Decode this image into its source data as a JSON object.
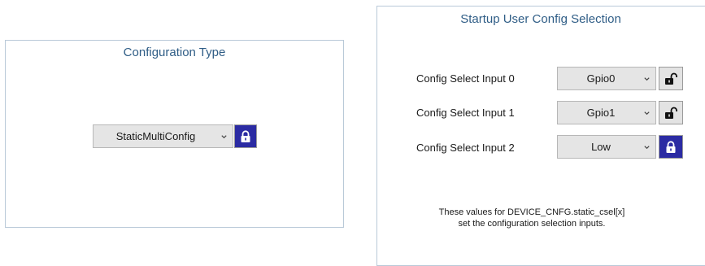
{
  "config_type_panel": {
    "title": "Configuration Type",
    "select_value": "StaticMultiConfig",
    "lock_state": "locked",
    "lock_icon": "lock-closed-icon"
  },
  "startup_panel": {
    "title": "Startup User Config Selection",
    "rows": [
      {
        "label": "Config Select Input 0",
        "value": "Gpio0",
        "lock_state": "unlocked",
        "lock_icon": "lock-open-icon"
      },
      {
        "label": "Config Select Input 1",
        "value": "Gpio1",
        "lock_state": "unlocked",
        "lock_icon": "lock-open-icon"
      },
      {
        "label": "Config Select Input 2",
        "value": "Low",
        "lock_state": "locked",
        "lock_icon": "lock-closed-icon"
      }
    ],
    "note_line1": "These values for DEVICE_CNFG.static_csel[x]",
    "note_line2": "set the configuration selection inputs."
  },
  "colors": {
    "title_blue": "#2f5d86",
    "panel_border": "#b9c9d8",
    "lock_locked_bg": "#2b2ba3",
    "lock_unlocked_bg": "#e3e3e3",
    "select_bg": "#e5e5e5"
  }
}
